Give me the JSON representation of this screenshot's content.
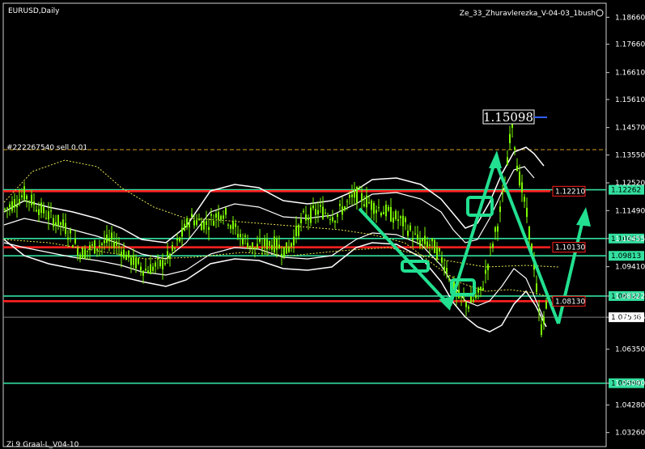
{
  "window": {
    "symbol_title": "EURUSD,Daily",
    "indicator_name": "Ze_33_Zhuravlerezka_V-04-03_1bush",
    "footer_label": "Zi 9 Graal-L_V04-10",
    "order_label": "#222267540 sell 0.01"
  },
  "colors": {
    "background": "#000000",
    "candles": "#7cfc00",
    "green_levels": "#33e0a0",
    "red_levels": "#ff2020",
    "dashed_order": "#d4a020",
    "arrows": "#22e090",
    "bands": "#ffffff",
    "ma_dotted": "#e8e850"
  },
  "price_scale": {
    "max": 1.19,
    "min": 1.025,
    "ticks": [
      "1.18660",
      "1.17660",
      "1.16610",
      "1.15610",
      "1.14570",
      "1.13550",
      "1.12520",
      "1.11490",
      "1.10455",
      "1.09410",
      "1.08322",
      "1.07536",
      "1.06350",
      "1.05090",
      "1.04280",
      "1.03260"
    ]
  },
  "price_tags": {
    "green": [
      {
        "label": "1.12262",
        "value": 1.12262
      },
      {
        "label": "1.10455",
        "value": 1.10455
      },
      {
        "label": "1.09813",
        "value": 1.09813
      },
      {
        "label": "1.08322",
        "value": 1.08322
      },
      {
        "label": "1.05090",
        "value": 1.0509
      }
    ],
    "red": [
      {
        "label": "1.12210",
        "value": 1.1221
      },
      {
        "label": "1.10130",
        "value": 1.1013
      },
      {
        "label": "1.08130",
        "value": 1.0813
      }
    ],
    "current": {
      "label": "1.07536",
      "value": 1.07536
    },
    "highlight": {
      "label": "1.15098",
      "value": 1.15098
    },
    "order_level": 1.1375
  }
}
